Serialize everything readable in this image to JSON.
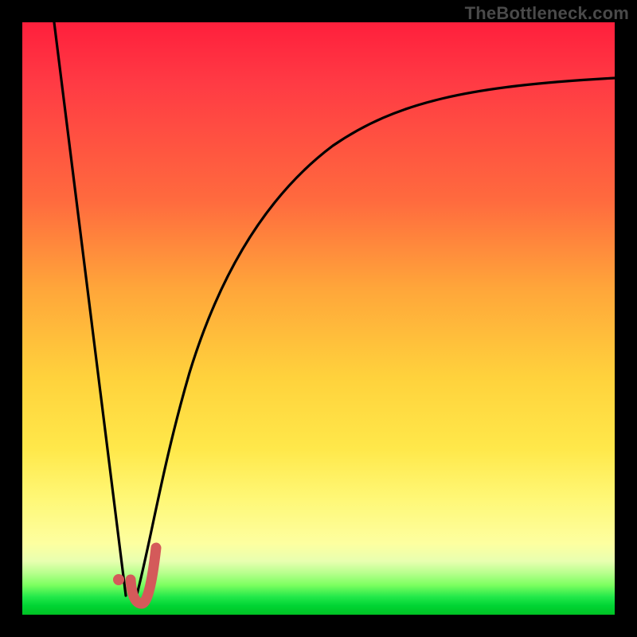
{
  "watermark": "TheBottleneck.com",
  "chart_data": {
    "type": "line",
    "title": "",
    "xlabel": "",
    "ylabel": "",
    "xlim": [
      0,
      100
    ],
    "ylim": [
      0,
      100
    ],
    "series": [
      {
        "name": "left-descent",
        "x": [
          5,
          17
        ],
        "y": [
          100,
          3
        ]
      },
      {
        "name": "right-ascent",
        "x": [
          19,
          22,
          26,
          30,
          36,
          44,
          54,
          66,
          80,
          100
        ],
        "y": [
          2,
          10,
          24,
          38,
          52,
          64,
          74,
          82,
          87,
          90
        ]
      },
      {
        "name": "hook-red",
        "x": [
          18.5,
          19,
          20,
          21,
          22
        ],
        "y": [
          4,
          2,
          2.5,
          5,
          11
        ],
        "color": "#d45a5a"
      }
    ],
    "points": [
      {
        "name": "hook-dot",
        "x": 16.5,
        "y": 6,
        "color": "#d45a5a"
      }
    ],
    "gradient_stops": [
      {
        "pos": 0,
        "color": "#ff1f3c"
      },
      {
        "pos": 0.45,
        "color": "#ffa63a"
      },
      {
        "pos": 0.8,
        "color": "#fff774"
      },
      {
        "pos": 0.95,
        "color": "#7cff60"
      },
      {
        "pos": 1.0,
        "color": "#00c224"
      }
    ]
  }
}
